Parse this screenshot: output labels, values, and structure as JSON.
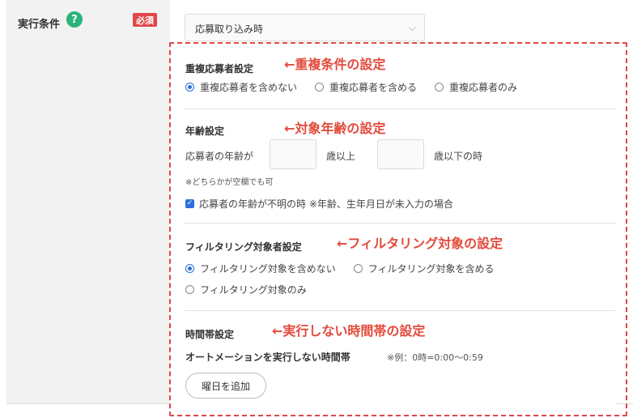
{
  "field": {
    "label": "実行条件",
    "help_glyph": "?",
    "required_badge": "必須",
    "select_value": "応募取り込み時",
    "chevron_glyph": "⌵"
  },
  "colors": {
    "accent": "#2a6fdb",
    "annotation": "#e24a3b",
    "required": "#e0464a",
    "help": "#2bb37b"
  },
  "duplicate": {
    "title": "重複応募者設定",
    "annotation": "←重複条件の設定",
    "options": [
      {
        "label": "重複応募者を含めない",
        "selected": true
      },
      {
        "label": "重複応募者を含める",
        "selected": false
      },
      {
        "label": "重複応募者のみ",
        "selected": false
      }
    ]
  },
  "age": {
    "title": "年齢設定",
    "annotation": "←対象年齢の設定",
    "prefix": "応募者の年齢が",
    "min_suffix": "歳以上",
    "max_suffix": "歳以下の時",
    "min_value": "",
    "max_value": "",
    "note": "※どちらかが空欄でも可",
    "unknown_label": "応募者の年齢が不明の時 ※年齢、生年月日が未入力の場合",
    "unknown_checked": true
  },
  "filter": {
    "title": "フィルタリング対象者設定",
    "annotation": "←フィルタリング対象の設定",
    "options": [
      {
        "label": "フィルタリング対象を含めない",
        "selected": true
      },
      {
        "label": "フィルタリング対象を含める",
        "selected": false
      },
      {
        "label": "フィルタリング対象のみ",
        "selected": false
      }
    ]
  },
  "time": {
    "title": "時間帯設定",
    "annotation": "←実行しない時間帯の設定",
    "subtitle": "オートメーションを実行しない時間帯",
    "example": "※例：0時=0:00〜0:59",
    "add_button": "曜日を追加"
  }
}
